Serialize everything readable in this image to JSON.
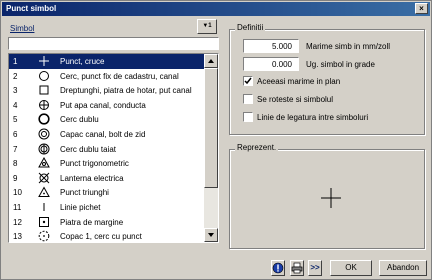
{
  "window": {
    "title": "Punct simbol",
    "close_glyph": "×"
  },
  "symbol_panel": {
    "label": "Simbol",
    "sort_glyph": "▼1",
    "search_value": "",
    "items": [
      {
        "num": "1",
        "icon": "plus-icon",
        "label": "Punct, cruce",
        "selected": true
      },
      {
        "num": "2",
        "icon": "circle-icon",
        "label": "Cerc, punct fix de cadastru, canal"
      },
      {
        "num": "3",
        "icon": "square-icon",
        "label": "Dreptunghi, piatra de hotar, put canal"
      },
      {
        "num": "4",
        "icon": "circle-cross-icon",
        "label": "Put apa canal, conducta"
      },
      {
        "num": "5",
        "icon": "double-circle-icon",
        "label": "Cerc dublu"
      },
      {
        "num": "6",
        "icon": "manhole-icon",
        "label": "Capac canal, bolt de zid"
      },
      {
        "num": "7",
        "icon": "cut-double-circle-icon",
        "label": "Cerc dublu taiat"
      },
      {
        "num": "8",
        "icon": "triangulation-icon",
        "label": "Punct trigonometric"
      },
      {
        "num": "9",
        "icon": "lantern-icon",
        "label": "Lanterna electrica"
      },
      {
        "num": "10",
        "icon": "triangle-icon",
        "label": "Punct triunghi"
      },
      {
        "num": "11",
        "icon": "picket-icon",
        "label": "Linie pichet"
      },
      {
        "num": "12",
        "icon": "square-dot-icon",
        "label": "Piatra de margine"
      },
      {
        "num": "13",
        "icon": "dashed-circle-icon",
        "label": "Copac 1, cerc cu punct"
      }
    ]
  },
  "definitions": {
    "title": "Definitii",
    "size_value": "5.000",
    "size_label": "Marime simb in mm/zoll",
    "angle_value": "0.000",
    "angle_label": "Ug. simbol in grade",
    "same_size_label": "Aceeasi marime in plan",
    "same_size_checked": true,
    "rotate_label": "Se roteste si simbolul",
    "rotate_checked": false,
    "link_label": "Linie de legatura intre simboluri",
    "link_checked": false
  },
  "preview": {
    "title": "Reprezent."
  },
  "buttons": {
    "info_glyph": "!",
    "print_glyph": "⎙",
    "more_label": ">>",
    "ok_label": "OK",
    "cancel_label": "Abandon"
  }
}
